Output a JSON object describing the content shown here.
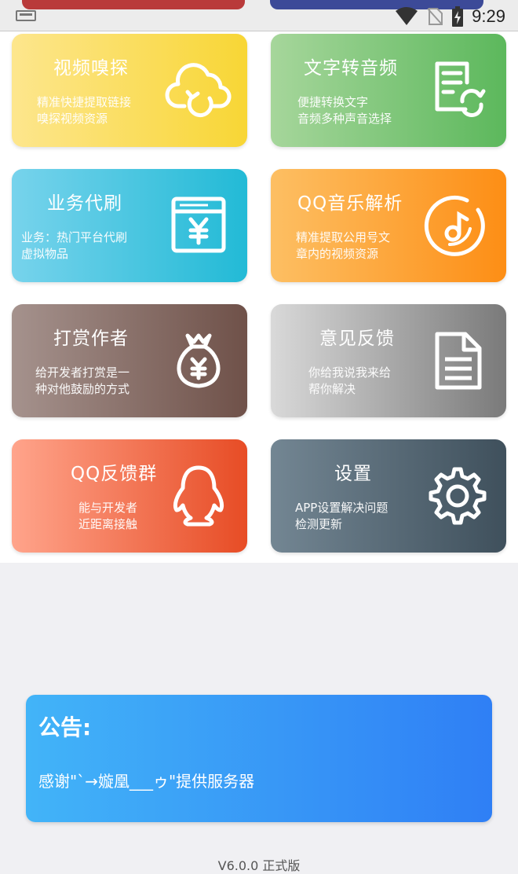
{
  "status_bar": {
    "time": "9:29",
    "icons": [
      "notification-icon",
      "wifi-icon",
      "no-sim-icon",
      "battery-charging-icon"
    ]
  },
  "cards": [
    {
      "title": "视频嗅探",
      "desc": "精准快捷提取链接\n嗅探视频资源",
      "icon": "cloud-refresh-icon"
    },
    {
      "title": "文字转音频",
      "desc": "便捷转换文字\n音频多种声音选择",
      "icon": "document-sync-icon"
    },
    {
      "title": "业务代刷",
      "desc": "业务：热门平台代刷\n虚拟物品",
      "icon": "yuan-window-icon"
    },
    {
      "title": "QQ音乐解析",
      "desc": "精准提取公用号文\n章内的视频资源",
      "icon": "music-disc-icon"
    },
    {
      "title": "打赏作者",
      "desc": "给开发者打赏是一\n种对他鼓励的方式",
      "icon": "money-bag-icon"
    },
    {
      "title": "意见反馈",
      "desc": "你给我说我来给\n帮你解决",
      "icon": "document-icon"
    },
    {
      "title": "QQ反馈群",
      "desc": "能与开发者\n近距离接触",
      "icon": "qq-penguin-icon"
    },
    {
      "title": "设置",
      "desc": "APP设置解决问题\n检测更新",
      "icon": "gear-icon"
    }
  ],
  "notice": {
    "title": "公告:",
    "text": "感谢\"ˋ→嫙凰___ゥ\"提供服务器"
  },
  "footer": {
    "version": "V6.0.0 正式版"
  },
  "colors": {
    "notice_start": "#42b4f8",
    "notice_end": "#2f7ff5"
  }
}
